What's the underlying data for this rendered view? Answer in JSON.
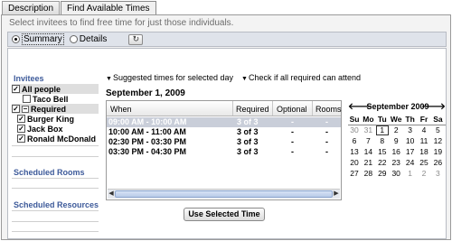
{
  "tabs": [
    {
      "label": "Description"
    },
    {
      "label": "Find Available Times"
    }
  ],
  "hint": "Select invitees to find free time for just those individuals.",
  "view_mode": {
    "summary_label": "Summary",
    "details_label": "Details",
    "selected": "Summary"
  },
  "left": {
    "invitees_title": "Invitees",
    "scheduled_rooms_title": "Scheduled Rooms",
    "scheduled_resources_title": "Scheduled Resources",
    "rows": [
      {
        "label": "All people",
        "checked": true,
        "kind": "group"
      },
      {
        "label": "Taco Bell",
        "checked": false,
        "kind": "person"
      },
      {
        "label": "Required",
        "checked": true,
        "kind": "group-collapsible"
      },
      {
        "label": "Burger King",
        "checked": true,
        "kind": "person"
      },
      {
        "label": "Jack Box",
        "checked": true,
        "kind": "person"
      },
      {
        "label": "Ronald McDonald",
        "checked": true,
        "kind": "person"
      }
    ]
  },
  "options": {
    "suggested_label": "Suggested times for selected day",
    "check_label": "Check if all required can attend"
  },
  "date_heading": "September 1, 2009",
  "grid": {
    "columns": [
      "When",
      "Required",
      "Optional",
      "Rooms"
    ],
    "rows": [
      {
        "when": "09:00 AM - 10:00 AM",
        "required": "3 of 3",
        "optional": "-",
        "rooms": "-",
        "selected": true
      },
      {
        "when": "10:00 AM - 11:00 AM",
        "required": "3 of 3",
        "optional": "-",
        "rooms": "-",
        "selected": false
      },
      {
        "when": "02:30 PM - 03:30 PM",
        "required": "3 of 3",
        "optional": "-",
        "rooms": "-",
        "selected": false
      },
      {
        "when": "03:30 PM - 04:30 PM",
        "required": "3 of 3",
        "optional": "-",
        "rooms": "-",
        "selected": false
      }
    ]
  },
  "use_button_label": "Use Selected Time",
  "calendar": {
    "month": "September",
    "year": "2009",
    "day_names": [
      "Su",
      "Mo",
      "Tu",
      "We",
      "Th",
      "Fr",
      "Sa"
    ],
    "weeks": [
      [
        "30",
        "31",
        "1",
        "2",
        "3",
        "4",
        "5"
      ],
      [
        "6",
        "7",
        "8",
        "9",
        "10",
        "11",
        "12"
      ],
      [
        "13",
        "14",
        "15",
        "16",
        "17",
        "18",
        "19"
      ],
      [
        "20",
        "21",
        "22",
        "23",
        "24",
        "25",
        "26"
      ],
      [
        "27",
        "28",
        "29",
        "30",
        "1",
        "2",
        "3"
      ]
    ],
    "selected_day": "1"
  },
  "icons": {
    "refresh": "refresh-icon",
    "prev": "arrow-left-icon",
    "next": "arrow-right-icon",
    "dropdown": "triangle-down-icon"
  }
}
